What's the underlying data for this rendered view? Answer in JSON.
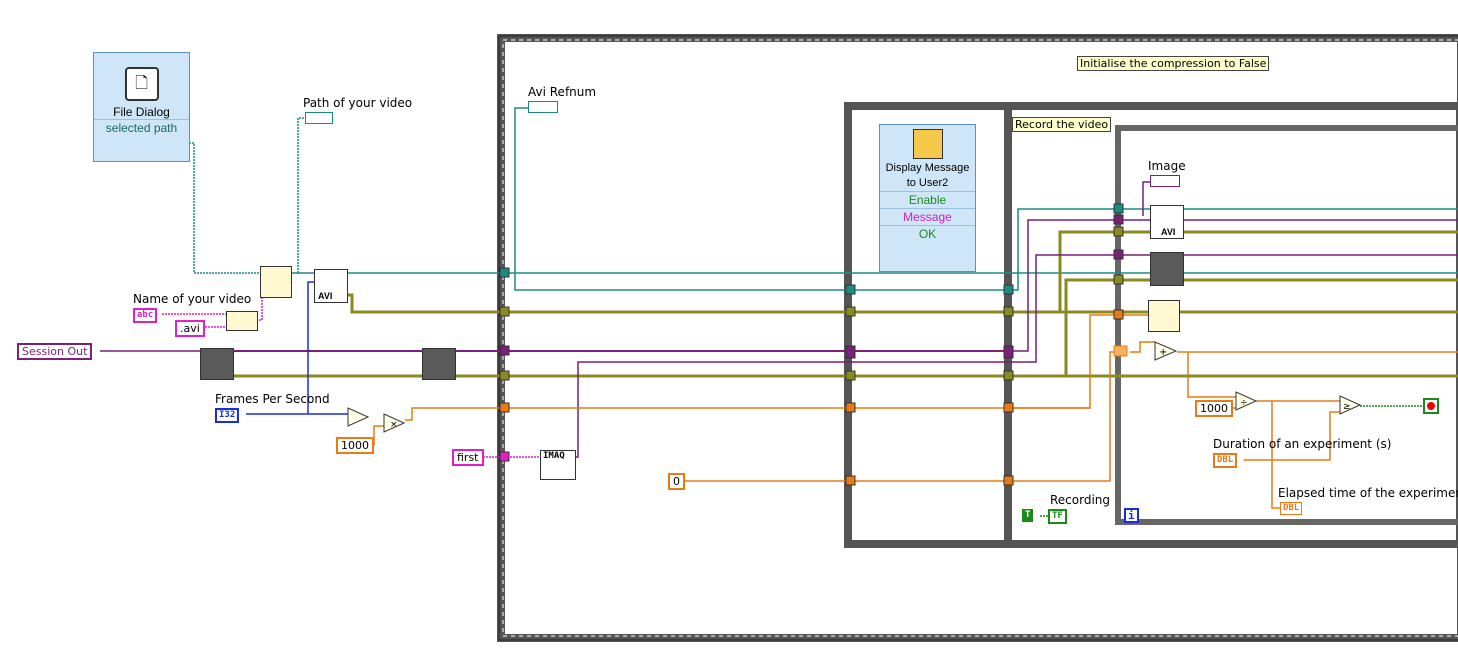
{
  "file_dialog": {
    "title": "File Dialog",
    "output": "selected path"
  },
  "labels": {
    "path_of_video": "Path of your video",
    "name_of_video": "Name of your video",
    "frames_per_second": "Frames Per Second",
    "avi_refnum": "Avi Refnum",
    "image": "Image",
    "recording": "Recording",
    "duration": "Duration of an experiment (s)",
    "elapsed": "Elapsed time of the experiment"
  },
  "comments": {
    "init_compression": "Initialise the compression to False",
    "record_video": "Record the video"
  },
  "constants": {
    "avi_ext": ".avi",
    "session_out": "Session Out",
    "k1000_a": "1000",
    "k1000_b": "1000",
    "first": "first",
    "zero": "0",
    "bool_true": "T"
  },
  "terminals": {
    "str": "abc",
    "i32": "I32",
    "dbl_in": "DBL",
    "dbl_out": "DBL",
    "tf": "TF",
    "imaq": "IMAQ",
    "avi1": "AVI",
    "avi2": "AVI",
    "loop_i": "i"
  },
  "display_message": {
    "title": "Display Message to User2",
    "rows": [
      "Enable",
      "Message",
      "OK"
    ]
  },
  "colors": {
    "teal": "#1a8c80",
    "purple": "#7a1f7a",
    "orange": "#e87b16",
    "olive": "#8a8a20",
    "pink": "#e020c8",
    "blue": "#1a2ed8",
    "green": "#1a8a1a"
  }
}
